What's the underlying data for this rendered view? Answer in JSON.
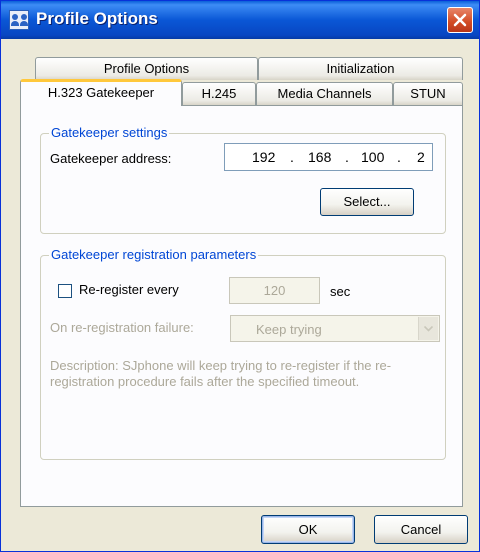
{
  "window": {
    "title": "Profile Options",
    "app_icon": "profile-people-icon",
    "close_icon": "close-icon"
  },
  "tabs": {
    "row1": [
      "Profile Options",
      "Initialization"
    ],
    "row2": [
      "H.323 Gatekeeper",
      "H.245",
      "Media Channels",
      "STUN"
    ],
    "active": "H.323 Gatekeeper"
  },
  "gatekeeper_settings": {
    "title": "Gatekeeper settings",
    "address_label": "Gatekeeper address:",
    "address_octets": [
      "192",
      "168",
      "100",
      "2"
    ],
    "separator": ".",
    "select_button": "Select..."
  },
  "registration": {
    "title": "Gatekeeper registration parameters",
    "reregister_label": "Re-register every",
    "reregister_checked": false,
    "interval_value": "120",
    "interval_unit": "sec",
    "failure_label": "On re-registration failure:",
    "failure_value": "Keep trying",
    "description": "Description: SJphone will keep trying to re-register if the re-registration procedure fails after the specified timeout."
  },
  "buttons": {
    "ok": "OK",
    "cancel": "Cancel"
  },
  "colors": {
    "title_bar": "#0a57d6",
    "group_title": "#0046d5",
    "disabled_text": "#aca899",
    "active_tab_accent": "#ffc83c",
    "close_button": "#d24a23"
  }
}
